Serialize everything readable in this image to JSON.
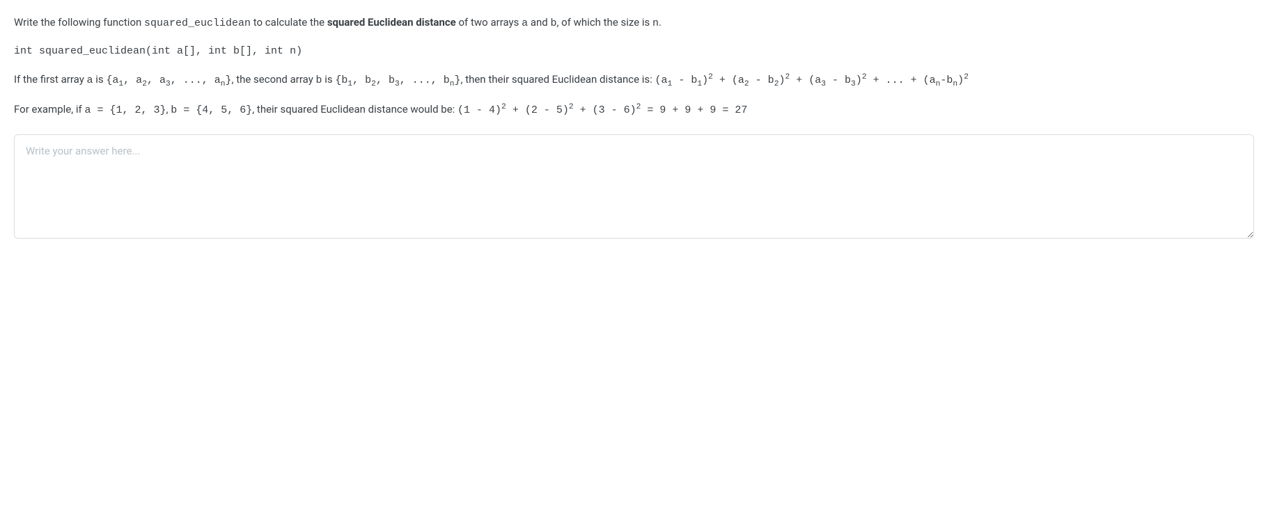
{
  "p1": {
    "t1": "Write the following function ",
    "fn": "squared_euclidean",
    "t2": " to calculate the ",
    "bold": "squared Euclidean distance",
    "t3": " of two arrays ",
    "a": "a",
    "t4": " and ",
    "b": "b",
    "t5": ",  of which the size is ",
    "n": "n",
    "t6": "."
  },
  "sig": "int squared_euclidean(int a[], int b[], int n)",
  "p3": {
    "t1": "If the first array ",
    "a": "a",
    "t2": " is ",
    "arrA_open": "{a",
    "comma_a": ", a",
    "ellipsis_a": ", ..., a",
    "close": "}",
    "t3": ", the second array ",
    "b": "b",
    "t4": " is ",
    "arrB_open": "{b",
    "comma_b": ", b",
    "ellipsis_b": ", ..., b",
    "t5": ", then their squared Euclidean distance is: ",
    "term_open": "(a",
    "minus_b": " - b",
    "close_paren": ")",
    "plus": " + ",
    "cont": "... + (a",
    "minus_bn": "-b",
    "idx1": "1",
    "idx2": "2",
    "idx3": "3",
    "idxn": "n",
    "sq": "2"
  },
  "p4": {
    "t1": "For example, if ",
    "ex_a": "a = {1, 2, 3}",
    "t2": ", ",
    "ex_b": "b = {4, 5, 6}",
    "t3": ", their squared Euclidean distance would be: ",
    "calc1": "(1 - 4)",
    "plus": " + ",
    "calc2": "(2 - 5)",
    "calc3": "(3 - 6)",
    "eq": " = 9 + 9 + 9 = 27",
    "sq": "2"
  },
  "answer": {
    "placeholder": "Write your answer here..."
  }
}
